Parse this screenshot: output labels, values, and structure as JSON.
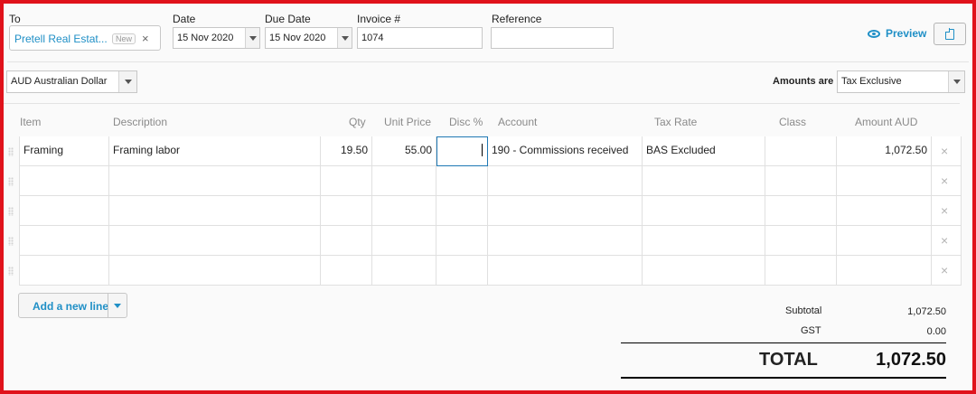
{
  "header": {
    "to_label": "To",
    "to_value": "Pretell Real Estat...",
    "to_badge": "New",
    "to_clear": "×",
    "date_label": "Date",
    "date_value": "15 Nov 2020",
    "due_label": "Due Date",
    "due_value": "15 Nov 2020",
    "invoice_label": "Invoice #",
    "invoice_value": "1074",
    "reference_label": "Reference",
    "reference_value": "",
    "preview_label": "Preview"
  },
  "options": {
    "currency": "AUD Australian Dollar",
    "amounts_label": "Amounts are",
    "amounts_value": "Tax Exclusive"
  },
  "table": {
    "columns": [
      "Item",
      "Description",
      "Qty",
      "Unit Price",
      "Disc %",
      "Account",
      "Tax Rate",
      "Class",
      "Amount AUD"
    ],
    "rows": [
      {
        "item": "Framing",
        "description": "Framing labor",
        "qty": "19.50",
        "unit_price": "55.00",
        "disc": "",
        "account": "190 - Commissions received",
        "tax_rate": "BAS Excluded",
        "class": "",
        "amount": "1,072.50"
      },
      {
        "item": "",
        "description": "",
        "qty": "",
        "unit_price": "",
        "disc": "",
        "account": "",
        "tax_rate": "",
        "class": "",
        "amount": ""
      },
      {
        "item": "",
        "description": "",
        "qty": "",
        "unit_price": "",
        "disc": "",
        "account": "",
        "tax_rate": "",
        "class": "",
        "amount": ""
      },
      {
        "item": "",
        "description": "",
        "qty": "",
        "unit_price": "",
        "disc": "",
        "account": "",
        "tax_rate": "",
        "class": "",
        "amount": ""
      },
      {
        "item": "",
        "description": "",
        "qty": "",
        "unit_price": "",
        "disc": "",
        "account": "",
        "tax_rate": "",
        "class": "",
        "amount": ""
      }
    ],
    "delete_glyph": "×"
  },
  "actions": {
    "add_line_label": "Add a new line"
  },
  "totals": {
    "subtotal_label": "Subtotal",
    "subtotal_value": "1,072.50",
    "gst_label": "GST",
    "gst_value": "0.00",
    "total_label": "TOTAL",
    "total_value": "1,072.50"
  },
  "colors": {
    "accent": "#1f8fc6",
    "frame_border": "#e0121b"
  }
}
